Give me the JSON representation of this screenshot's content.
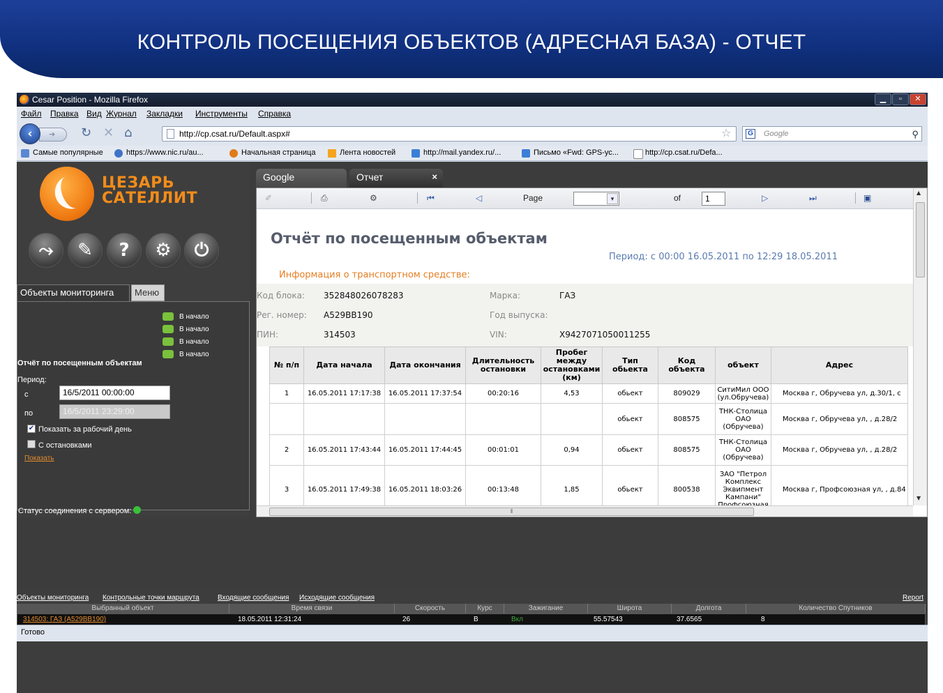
{
  "slide": {
    "title": "КОНТРОЛЬ ПОСЕЩЕНИЯ ОБЪЕКТОВ (АДРЕСНАЯ БАЗА) - ОТЧЕТ"
  },
  "browser": {
    "window_title": "Cesar Position - Mozilla Firefox",
    "menu": [
      "Файл",
      "Правка",
      "Вид",
      "Журнал",
      "Закладки",
      "Инструменты",
      "Справка"
    ],
    "url": "http://cp.csat.ru/Default.aspx#",
    "search_placeholder": "Google",
    "bookmarks": [
      "Самые популярные",
      "https://www.nic.ru/au...",
      "Начальная страница",
      "Лента новостей",
      "http://mail.yandex.ru/...",
      "Письмо «Fwd: GPS-ус...",
      "http://cp.csat.ru/Defa..."
    ],
    "status": "Готово"
  },
  "sidebar": {
    "logo_line1": "ЦЕЗАРЬ",
    "logo_line2": "САТЕЛЛИТ",
    "tools": [
      "route-icon",
      "brush-icon",
      "help-icon",
      "gear-icon",
      "power-icon"
    ],
    "tab_objects": "Объекты мониторинга",
    "tab_menu": "Меню",
    "nav_links": [
      "В начало",
      "В начало",
      "В начало",
      "В начало"
    ],
    "report_heading": "Отчёт по посещенным объектам",
    "period_label": "Период:",
    "from_label": "с",
    "from_value": "16/5/2011 00:00:00",
    "to_label": "по",
    "to_value": "16/5/2011 23:29:00",
    "workday_checkbox": "Показать за рабочий день",
    "stops_checkbox": "С остановками",
    "show_link": "Показать",
    "connection_status": "Статус соединения с сервером:"
  },
  "report_tabs": {
    "google": "Google",
    "report": "Отчет"
  },
  "toolbar": {
    "page_label": "Page",
    "of_label": "of",
    "page_value": "1"
  },
  "report": {
    "title": "Отчёт по посещенным объектам",
    "period": "Период: с 00:00  16.05.2011 по 12:29  18.05.2011",
    "vehicle_info_heading": "Информация о транспортном средстве:",
    "fields": {
      "block_code_label": "Код блока:",
      "block_code": "352848026078283",
      "brand_label": "Марка:",
      "brand": "ГАЗ",
      "reg_label": "Рег. номер:",
      "reg": "А529ВВ190",
      "year_label": "Год выпуска:",
      "year": "",
      "pin_label": "ПИН:",
      "pin": "314503",
      "vin_label": "VIN:",
      "vin": "X9427071050011255"
    },
    "columns": [
      "№ п/п",
      "Дата начала",
      "Дата окончания",
      "Длительность остановки",
      "Пробег между остановками (км)",
      "Тип обьекта",
      "Код объекта",
      "объект",
      "Адрес"
    ],
    "rows": [
      [
        "1",
        "16.05.2011 17:17:38",
        "16.05.2011 17:37:54",
        "00:20:16",
        "4,53",
        "обьект",
        "809029",
        "СитиМил ООО (ул.Обручева)",
        "Москва г, Обручева ул, д.30/1, с"
      ],
      [
        "",
        "",
        "",
        "",
        "",
        "обьект",
        "808575",
        "ТНК-Столица ОАО (Обручева)",
        "Москва г, Обручева ул, , д.28/2"
      ],
      [
        "2",
        "16.05.2011 17:43:44",
        "16.05.2011 17:44:45",
        "00:01:01",
        "0,94",
        "обьект",
        "808575",
        "ТНК-Столица ОАО (Обручева)",
        "Москва г, Обручева ул, , д.28/2"
      ],
      [
        "3",
        "16.05.2011 17:49:38",
        "16.05.2011 18:03:26",
        "00:13:48",
        "1,85",
        "обьект",
        "800538",
        "ЗАО \"Петрол Комплекс Эквипмент Кампани\" Профсоюзная",
        "Москва г, Профсоюзная ул, , д.84"
      ]
    ]
  },
  "bottom": {
    "links": [
      "Объекты мониторинга",
      "Контрольные точки маршрута",
      "Входящие сообщения",
      "Исходящие сообщения"
    ],
    "report_link": "Report",
    "columns": [
      "Выбранный объект",
      "Время связи",
      "Скорость",
      "Курс",
      "Зажигание",
      "Широта",
      "Долгота",
      "Количество Спутников"
    ],
    "row": [
      "314503: ГАЗ (А529ВВ190)",
      "18.05.2011 12:31:24",
      "26",
      "В",
      "Вкл",
      "55.57543",
      "37.6565",
      "8"
    ]
  }
}
